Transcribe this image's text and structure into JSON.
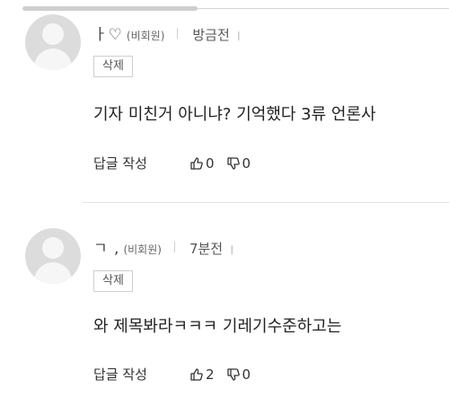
{
  "comments": [
    {
      "nickname": "ㅏ♡",
      "member_tag": "(비회원)",
      "time": "방금전",
      "ip": "ㅣ",
      "delete_label": "삭제",
      "text": "기자 미친거 아니냐? 기억했다 3류 언론사",
      "reply_label": "답글 작성",
      "like_icon": "thumbs-up-outline",
      "likes": "0",
      "dislike_icon": "thumbs-down-outline",
      "dislikes": "0"
    },
    {
      "nickname": "ㄱ ,",
      "member_tag": "(비회원)",
      "time": "7분전",
      "ip": "ㅣ",
      "delete_label": "삭제",
      "text": "와 제목봐라ㅋㅋㅋ 기레기수준하고는",
      "reply_label": "답글 작성",
      "like_icon": "thumbs-up-outline",
      "likes": "2",
      "dislike_icon": "thumbs-down-outline",
      "dislikes": "0"
    }
  ]
}
